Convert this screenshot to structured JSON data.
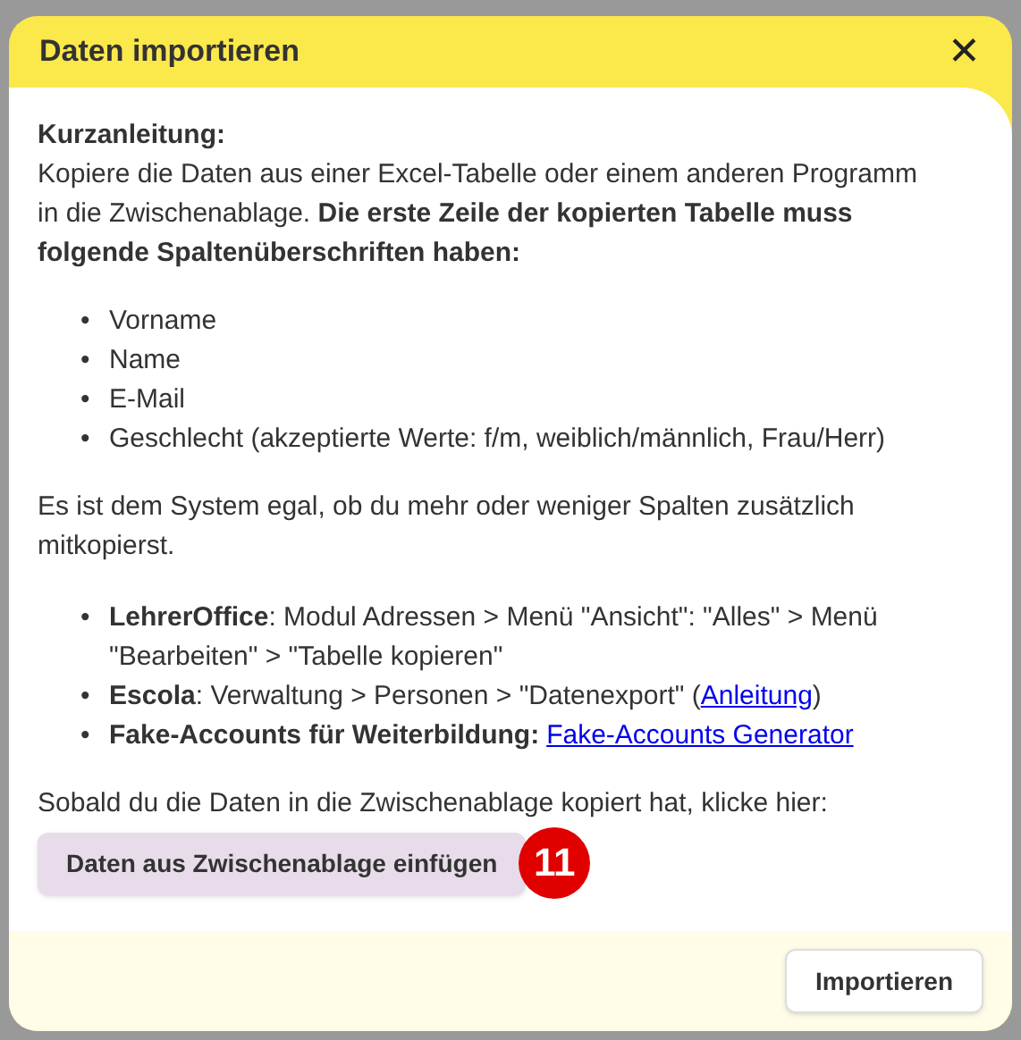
{
  "dialog": {
    "title": "Daten importieren",
    "close": "✕"
  },
  "heading": "Kurzanleitung:",
  "intro": "Kopiere die Daten aus einer Excel-Tabelle oder einem anderen Programm in die Zwischenablage. **Die erste Zeile der kopierten Tabelle muss folgende Spaltenüberschriften haben:**",
  "columns": [
    "Vorname",
    "Name",
    "E-Mail",
    "Geschlecht (akzeptierte Werte: f/m, weiblich/männlich, Frau/Herr)"
  ],
  "note": "Es ist dem System egal, ob du mehr oder weniger Spalten zusätzlich mitkopierst.",
  "sources": [
    {
      "label": "LehrerOffice",
      "text": ": Modul Adressen > Menü \"Ansicht\": \"Alles\" > Menü \"Bearbeiten\" > \"Tabelle kopieren\""
    },
    {
      "label": "Escola",
      "text": ": Verwaltung > Personen > \"Datenexport\" (",
      "link": "Anleitung",
      "after": ")"
    },
    {
      "label": "Fake-Accounts für Weiterbildung:",
      "link": "Fake-Accounts Generator"
    }
  ],
  "bullet": "•",
  "paste_hint": "Sobald du die Daten in die Zwischenablage kopiert hat, klicke hier:",
  "paste_button": "Daten aus Zwischenablage einfügen",
  "badge": "11",
  "import_button": "Importieren"
}
